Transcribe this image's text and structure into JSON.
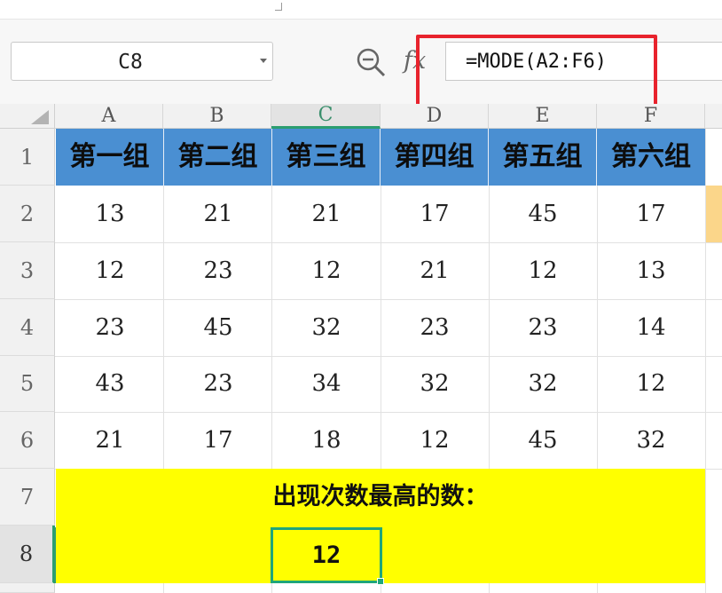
{
  "name_box": {
    "value": "C8"
  },
  "formula_bar": {
    "fx_label": "fx",
    "formula": "=MODE(A2:F6)"
  },
  "columns": [
    "A",
    "B",
    "C",
    "D",
    "E",
    "F"
  ],
  "rows": [
    "1",
    "2",
    "3",
    "4",
    "5",
    "6",
    "7",
    "8"
  ],
  "selected": {
    "column": "C",
    "row": "8"
  },
  "table": {
    "headers": [
      "第一组",
      "第二组",
      "第三组",
      "第四组",
      "第五组",
      "第六组"
    ],
    "values": [
      [
        "13",
        "21",
        "21",
        "17",
        "45",
        "17"
      ],
      [
        "12",
        "23",
        "12",
        "21",
        "12",
        "13"
      ],
      [
        "23",
        "45",
        "32",
        "23",
        "23",
        "14"
      ],
      [
        "43",
        "23",
        "34",
        "32",
        "32",
        "12"
      ],
      [
        "21",
        "17",
        "18",
        "12",
        "45",
        "32"
      ]
    ]
  },
  "result": {
    "label": "出现次数最高的数：",
    "value": "12"
  },
  "colors": {
    "header_fill": "#4a8fd2",
    "result_fill": "#ffff00",
    "highlight_border": "#e8232d",
    "selection_green": "#1fa67a"
  },
  "icons": {
    "zoom": "zoom-out-icon",
    "fx": "fx-icon",
    "dropdown": "chevron-down-icon"
  }
}
